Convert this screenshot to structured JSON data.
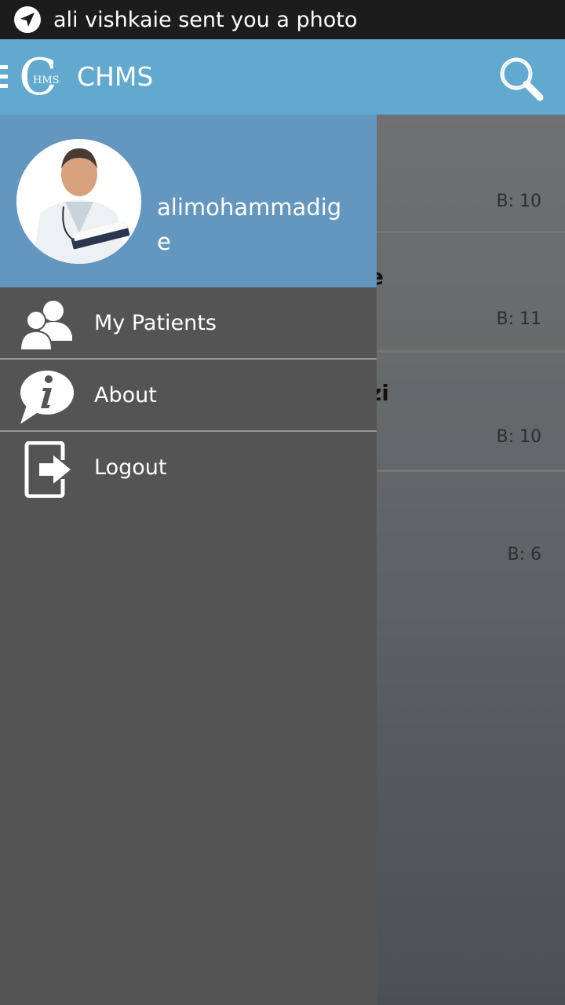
{
  "status_bar": {
    "notification_text": "ali vishkaie sent you a photo",
    "icon": "navigation-arrow-icon"
  },
  "action_bar": {
    "logo_letter": "C",
    "logo_sub": "HMS",
    "title": "CHMS",
    "background": "#62a9d0"
  },
  "drawer": {
    "user_name": "alimohammadige",
    "header_color": "#6497c0",
    "items": [
      {
        "label": "My Patients",
        "icon": "patients-icon"
      },
      {
        "label": "About",
        "icon": "info-bubble-icon"
      },
      {
        "label": "Logout",
        "icon": "logout-icon"
      }
    ]
  },
  "background_list": {
    "rows": [
      {
        "name_fragment": "",
        "badge": "B: 10"
      },
      {
        "name_fragment": "e",
        "badge": "B: 11"
      },
      {
        "name_fragment": "zi",
        "badge": "B: 10"
      },
      {
        "name_fragment": "",
        "badge": "B: 6"
      }
    ]
  }
}
